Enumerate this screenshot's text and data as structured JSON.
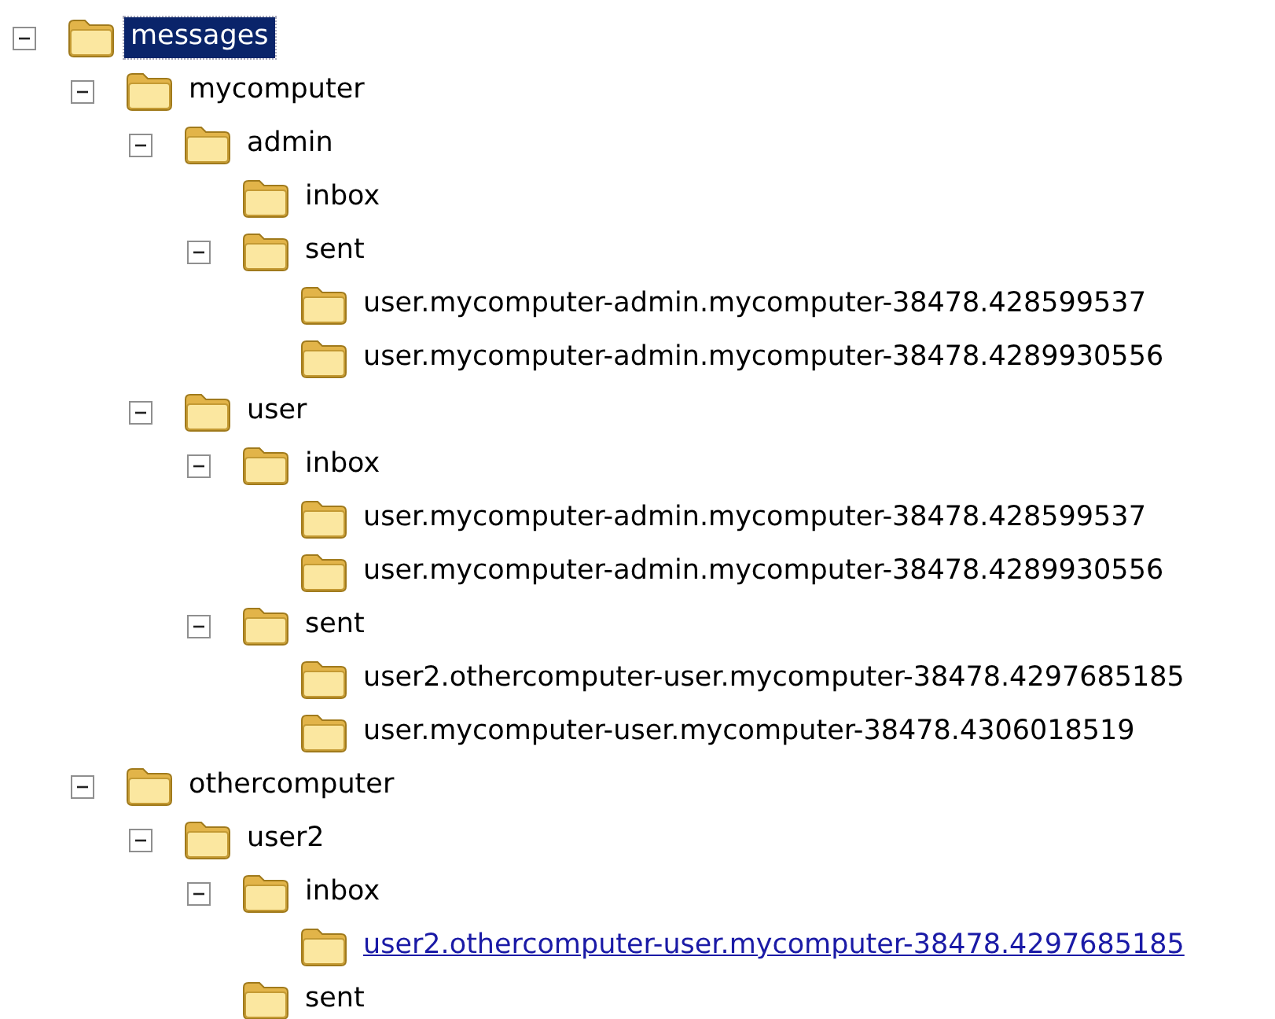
{
  "tree": [
    {
      "label": "messages",
      "selected": true,
      "hot": false,
      "expanded": true,
      "children": [
        {
          "label": "mycomputer",
          "selected": false,
          "hot": false,
          "expanded": true,
          "children": [
            {
              "label": "admin",
              "selected": false,
              "hot": false,
              "expanded": true,
              "children": [
                {
                  "label": "inbox",
                  "selected": false,
                  "hot": false
                },
                {
                  "label": "sent",
                  "selected": false,
                  "hot": false,
                  "expanded": true,
                  "children": [
                    {
                      "label": "user.mycomputer-admin.mycomputer-38478.428599537",
                      "selected": false,
                      "hot": false
                    },
                    {
                      "label": "user.mycomputer-admin.mycomputer-38478.4289930556",
                      "selected": false,
                      "hot": false
                    }
                  ]
                }
              ]
            },
            {
              "label": "user",
              "selected": false,
              "hot": false,
              "expanded": true,
              "children": [
                {
                  "label": "inbox",
                  "selected": false,
                  "hot": false,
                  "expanded": true,
                  "children": [
                    {
                      "label": "user.mycomputer-admin.mycomputer-38478.428599537",
                      "selected": false,
                      "hot": false
                    },
                    {
                      "label": "user.mycomputer-admin.mycomputer-38478.4289930556",
                      "selected": false,
                      "hot": false
                    }
                  ]
                },
                {
                  "label": "sent",
                  "selected": false,
                  "hot": false,
                  "expanded": true,
                  "children": [
                    {
                      "label": "user2.othercomputer-user.mycomputer-38478.4297685185",
                      "selected": false,
                      "hot": false
                    },
                    {
                      "label": "user.mycomputer-user.mycomputer-38478.4306018519",
                      "selected": false,
                      "hot": false
                    }
                  ]
                }
              ]
            }
          ]
        },
        {
          "label": "othercomputer",
          "selected": false,
          "hot": false,
          "expanded": true,
          "children": [
            {
              "label": "user2",
              "selected": false,
              "hot": false,
              "expanded": true,
              "children": [
                {
                  "label": "inbox",
                  "selected": false,
                  "hot": false,
                  "expanded": true,
                  "children": [
                    {
                      "label": "user2.othercomputer-user.mycomputer-38478.4297685185",
                      "selected": false,
                      "hot": true
                    }
                  ]
                },
                {
                  "label": "sent",
                  "selected": false,
                  "hot": false
                }
              ]
            }
          ]
        }
      ]
    }
  ]
}
